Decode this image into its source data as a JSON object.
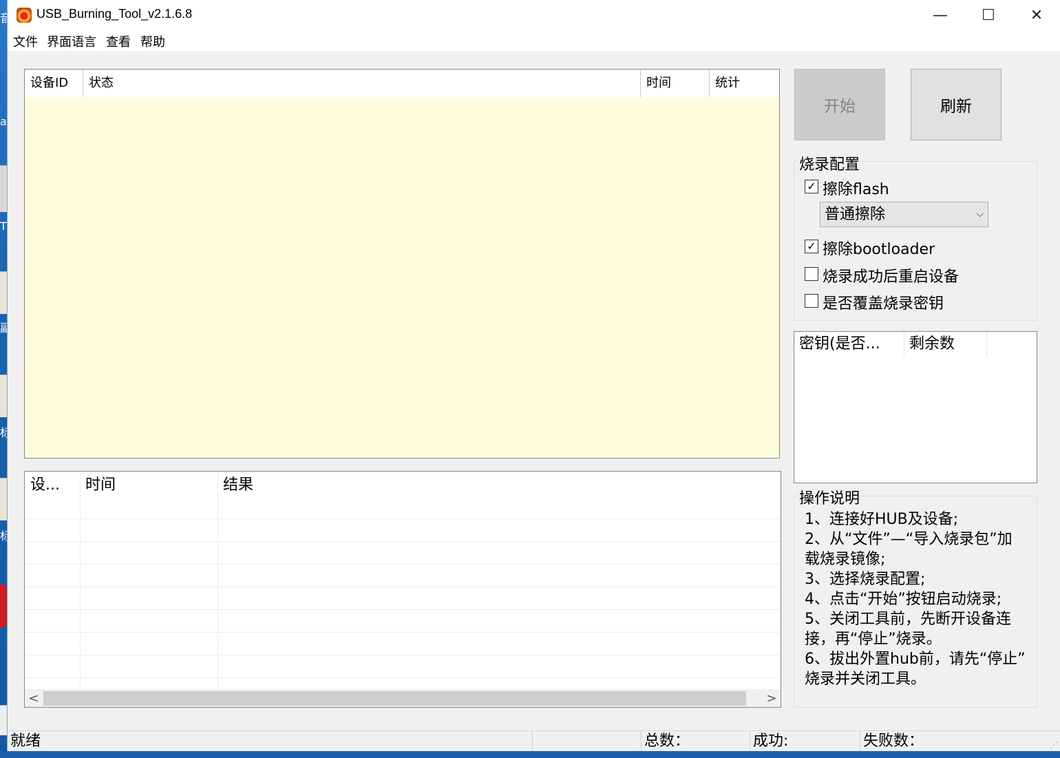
{
  "window": {
    "title": "USB_Burning_Tool_v2.1.6.8",
    "minimize_glyph": "—",
    "maximize_glyph": "☐",
    "close_glyph": "✕"
  },
  "menu": [
    "文件",
    "界面语言",
    "查看",
    "帮助"
  ],
  "device_table": {
    "columns": [
      "设备ID",
      "状态",
      "时间",
      "统计"
    ],
    "background": "#fffedc"
  },
  "log_table": {
    "columns": [
      "设...",
      "时间",
      "结果"
    ]
  },
  "buttons": {
    "start": "开始",
    "refresh": "刷新"
  },
  "burn_config": {
    "title": "烧录配置",
    "erase_flash": {
      "label": "擦除flash",
      "checked": true
    },
    "erase_mode": "普通擦除",
    "erase_bootloader": {
      "label": "擦除bootloader",
      "checked": true
    },
    "reboot_after": {
      "label": "烧录成功后重启设备",
      "checked": false
    },
    "overwrite_key": {
      "label": "是否覆盖烧录密钥",
      "checked": false
    }
  },
  "key_table": {
    "columns": [
      "密钥(是否...",
      "剩余数"
    ]
  },
  "instructions": {
    "title": "操作说明",
    "lines": [
      "1、连接好HUB及设备;",
      "2、从“文件”—“导入烧录包”加",
      "载烧录镜像;",
      "3、选择烧录配置;",
      "4、点击“开始”按钮启动烧录;",
      "5、关闭工具前，先断开设备连",
      "接，再“停止”烧录。",
      "6、拔出外置hub前，请先“停止”",
      "烧录并关闭工具。"
    ]
  },
  "status_bar": {
    "ready": "就绪",
    "total": "总数：",
    "success": "成功:",
    "failed": "失败数："
  },
  "icons": {
    "checkbox_checked": "✓",
    "dropdown": "⌵",
    "scroll_left": "<",
    "scroll_right": ">",
    "resize_grip": "⋰"
  }
}
